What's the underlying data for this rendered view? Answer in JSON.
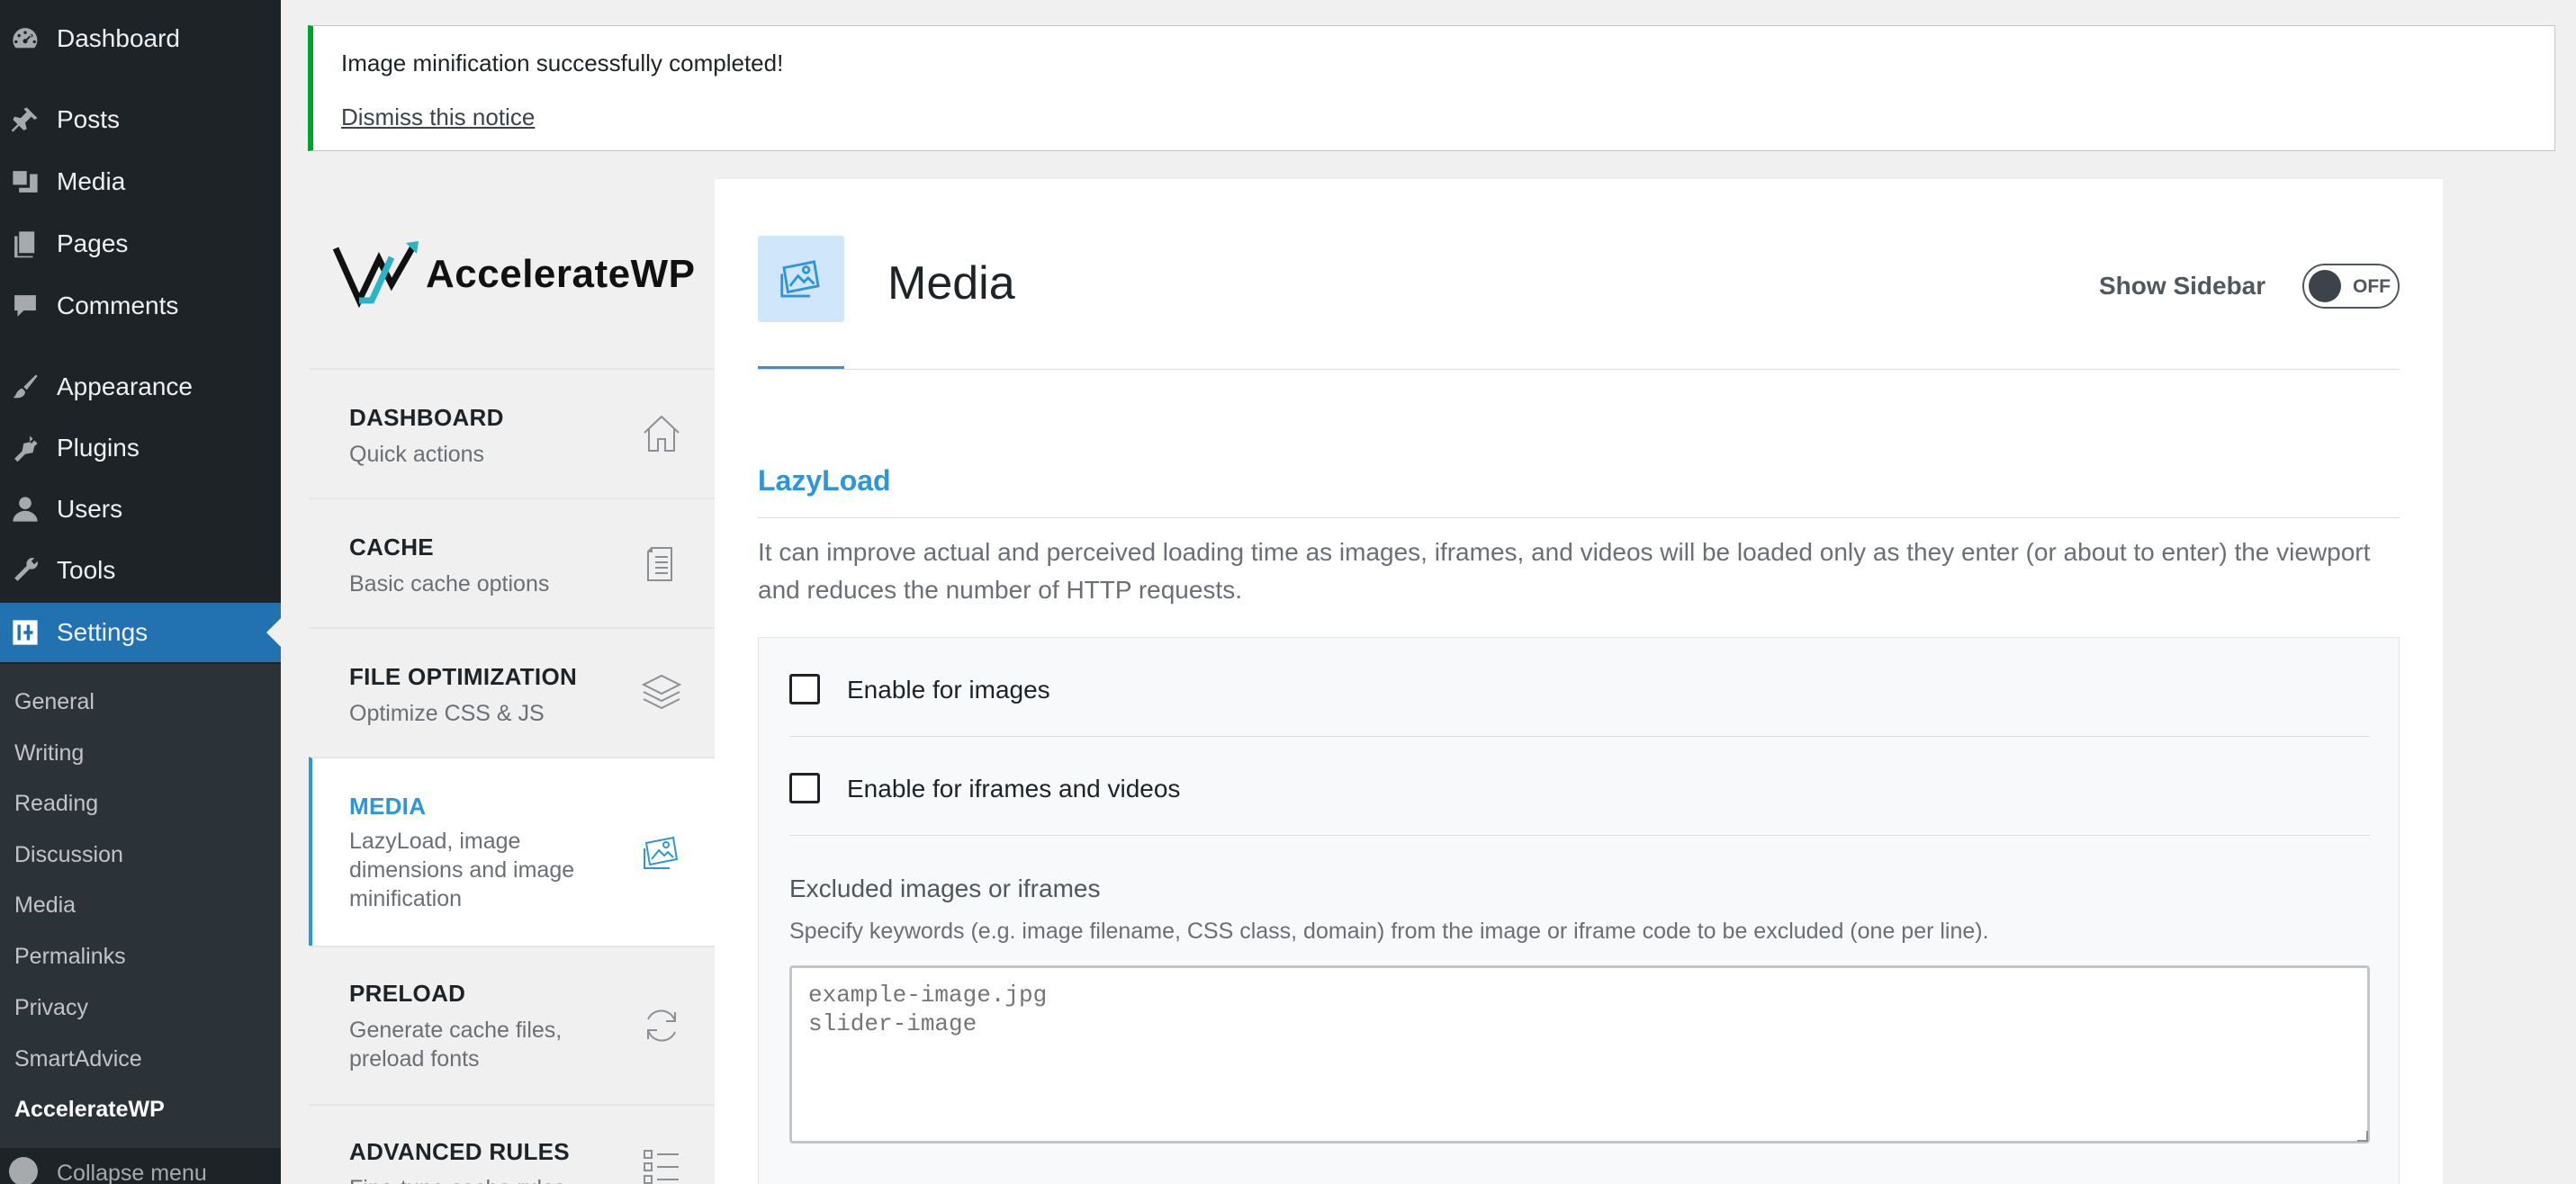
{
  "wp_menu": {
    "items": [
      {
        "label": "Dashboard",
        "icon": "dashboard-icon"
      },
      {
        "label": "Posts",
        "icon": "pin-icon"
      },
      {
        "label": "Media",
        "icon": "media-icon"
      },
      {
        "label": "Pages",
        "icon": "pages-icon"
      },
      {
        "label": "Comments",
        "icon": "comment-icon"
      },
      {
        "label": "Appearance",
        "icon": "brush-icon"
      },
      {
        "label": "Plugins",
        "icon": "plug-icon"
      },
      {
        "label": "Users",
        "icon": "user-icon"
      },
      {
        "label": "Tools",
        "icon": "wrench-icon"
      },
      {
        "label": "Settings",
        "icon": "settings-icon"
      }
    ],
    "active": "Settings",
    "submenu": [
      "General",
      "Writing",
      "Reading",
      "Discussion",
      "Media",
      "Permalinks",
      "Privacy",
      "SmartAdvice",
      "AccelerateWP"
    ],
    "submenu_current": "AccelerateWP",
    "collapse_label": "Collapse menu"
  },
  "notice": {
    "message": "Image minification successfully completed!",
    "dismiss": "Dismiss this notice",
    "accent_color": "#00a32a"
  },
  "plugin": {
    "logo_text": "AccelerateWP",
    "nav": [
      {
        "title": "DASHBOARD",
        "desc": "Quick actions",
        "icon": "home-icon"
      },
      {
        "title": "CACHE",
        "desc": "Basic cache options",
        "icon": "document-icon"
      },
      {
        "title": "FILE OPTIMIZATION",
        "desc": "Optimize CSS & JS",
        "icon": "layers-icon"
      },
      {
        "title": "MEDIA",
        "desc": "LazyLoad, image dimensions and image minification",
        "icon": "images-icon"
      },
      {
        "title": "PRELOAD",
        "desc": "Generate cache files, preload fonts",
        "icon": "refresh-icon"
      },
      {
        "title": "ADVANCED RULES",
        "desc": "Fine-tune cache rules",
        "icon": "checklist-icon"
      }
    ],
    "active_nav": "MEDIA",
    "accent_color": "#2c95de"
  },
  "page": {
    "title": "Media",
    "show_sidebar_label": "Show Sidebar",
    "show_sidebar_state": "OFF",
    "section": {
      "title": "LazyLoad",
      "description": "It can improve actual and perceived loading time as images, iframes, and videos will be loaded only as they enter (or about to enter) the viewport and reduces the number of HTTP requests.",
      "options": [
        {
          "label": "Enable for images",
          "checked": false
        },
        {
          "label": "Enable for iframes and videos",
          "checked": false
        }
      ],
      "excluded": {
        "label": "Excluded images or iframes",
        "help": "Specify keywords (e.g. image filename, CSS class, domain) from the image or iframe code to be excluded (one per line).",
        "placeholder": "example-image.jpg\nslider-image"
      }
    }
  }
}
